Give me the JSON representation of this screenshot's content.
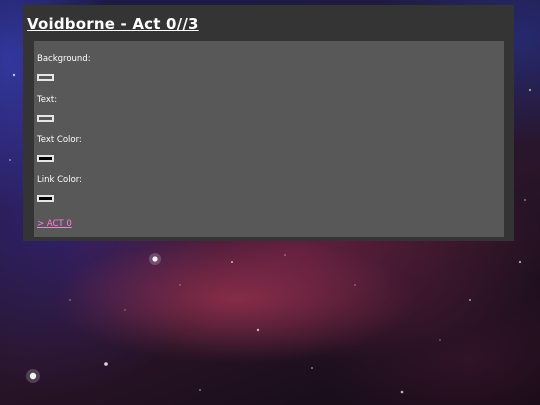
{
  "page": {
    "title": "Voidborne - Act 0//3"
  },
  "settings": {
    "background_label": "Background:",
    "text_label": "Text:",
    "text_color_label": "Text Color:",
    "link_color_label": "Link Color:"
  },
  "links": {
    "act_label": "> ACT 0"
  },
  "colors": {
    "panel": "#343434",
    "inner_panel": "#585858",
    "text": "#ffffff",
    "link": "#ff7fe0",
    "swatch_border": "#e6e6e6",
    "swatch_dark": "#000000"
  }
}
